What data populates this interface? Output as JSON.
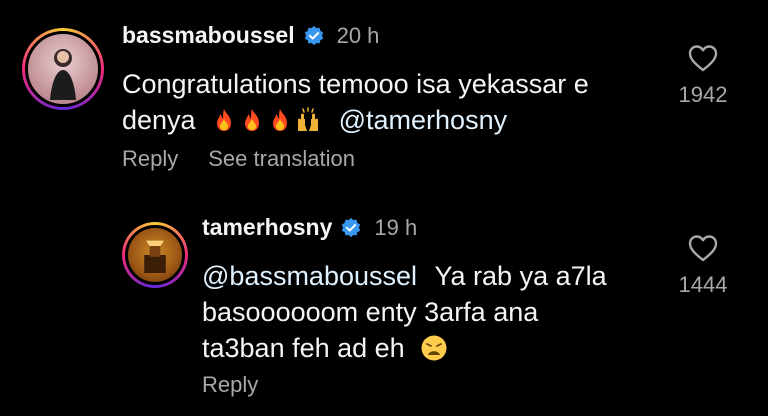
{
  "comments": [
    {
      "username": "bassmaboussel",
      "time": "20 h",
      "text_line1": "Congratulations temooo isa yekassar e",
      "text_line2_word": "denya",
      "text_line2_mention": "@tamerhosny",
      "reply_label": "Reply",
      "translate_label": "See translation",
      "like_count": "1942",
      "emojis": [
        "fire-emoji",
        "fire-emoji",
        "fire-emoji",
        "raising-hands-emoji"
      ]
    },
    {
      "username": "tamerhosny",
      "time": "19 h",
      "mention": "@bassmaboussel",
      "text_after_mention": "Ya rab ya a7la",
      "text_line2": "basoooooom enty 3arfa ana",
      "text_line3": "ta3ban feh ad eh",
      "reply_label": "Reply",
      "like_count": "1444",
      "emojis": [
        "weary-face-emoji"
      ]
    }
  ],
  "colors": {
    "background": "#000000",
    "text": "#f5f5f5",
    "secondary": "#a8a8a8",
    "verified": "#3897f0"
  }
}
